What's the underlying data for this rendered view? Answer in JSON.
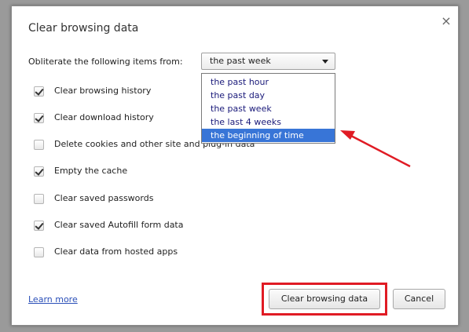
{
  "dialog": {
    "title": "Clear browsing data",
    "close_glyph": "×"
  },
  "obliterate": {
    "label": "Obliterate the following items from:",
    "selected_value": "the past week",
    "options": [
      "the past hour",
      "the past day",
      "the past week",
      "the last 4 weeks",
      "the beginning of time"
    ],
    "highlighted_option": "the beginning of time"
  },
  "checkboxes": [
    {
      "label": "Clear browsing history",
      "checked": true
    },
    {
      "label": "Clear download history",
      "checked": true
    },
    {
      "label": "Delete cookies and other site and plug-in data",
      "checked": false
    },
    {
      "label": "Empty the cache",
      "checked": true
    },
    {
      "label": "Clear saved passwords",
      "checked": false
    },
    {
      "label": "Clear saved Autofill form data",
      "checked": true
    },
    {
      "label": "Clear data from hosted apps",
      "checked": false
    }
  ],
  "footer": {
    "learn_more": "Learn more",
    "clear_button": "Clear browsing data",
    "cancel_button": "Cancel"
  },
  "annotations": {
    "color": "#e01b24",
    "arrow": "red arrow pointing to 'the beginning of time'",
    "box": "red box around 'Clear browsing data' button"
  }
}
